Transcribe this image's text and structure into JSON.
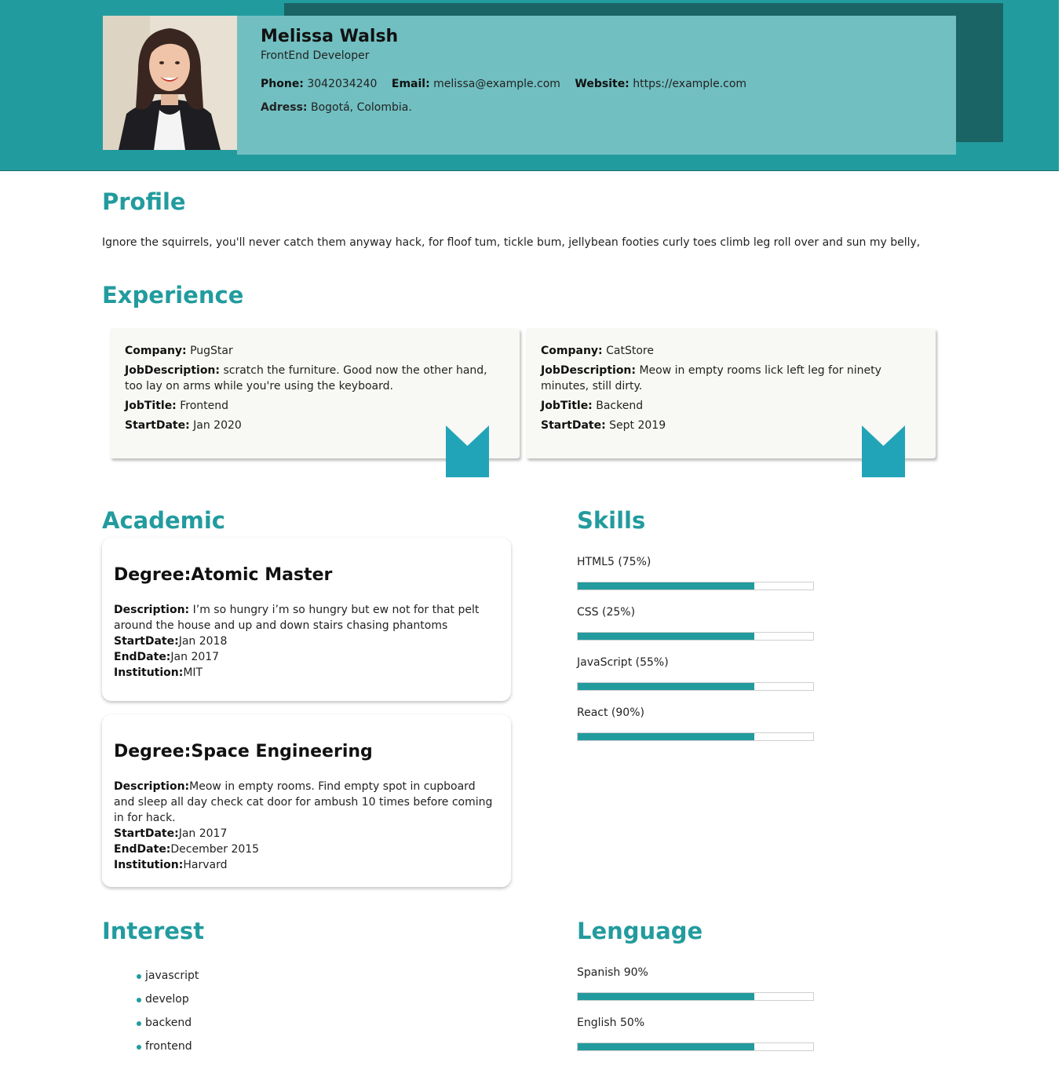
{
  "header": {
    "name": "Melissa Walsh",
    "role": "FrontEnd Developer",
    "phone_label": "Phone:",
    "phone": "3042034240",
    "email_label": "Email:",
    "email": "melissa@example.com",
    "website_label": "Website:",
    "website": "https://example.com",
    "address_label": "Adress:",
    "address": "Bogotá, Colombia."
  },
  "profile": {
    "title": "Profile",
    "text": "Ignore the squirrels, you'll never catch them anyway hack, for floof tum, tickle bum, jellybean footies curly toes climb leg roll over and sun my belly,"
  },
  "experience": {
    "title": "Experience",
    "labels": {
      "company": "Company:",
      "description": "JobDescription:",
      "job_title": "JobTitle:",
      "start_date": "StartDate:"
    },
    "items": [
      {
        "company": "PugStar",
        "description": "scratch the furniture. Good now the other hand, too lay on arms while you're using the keyboard.",
        "job_title": "Frontend",
        "start_date": "Jan 2020"
      },
      {
        "company": "CatStore",
        "description": "Meow in empty rooms lick left leg for ninety minutes, still dirty.",
        "job_title": "Backend",
        "start_date": "Sept 2019"
      }
    ]
  },
  "academic": {
    "title": "Academic",
    "labels": {
      "degree": "Degree:",
      "description": "Description:",
      "start_date": "StartDate:",
      "end_date": "EndDate:",
      "institution": "Institution:"
    },
    "items": [
      {
        "degree": "Atomic Master",
        "description": "I’m so hungry i’m so hungry but ew not for that pelt around the house and up and down stairs chasing phantoms",
        "start_date": "Jan 2018",
        "end_date": "Jan 2017",
        "institution": "MIT"
      },
      {
        "degree": "Space Engineering",
        "description": "Meow in empty rooms. Find empty spot in cupboard and sleep all day check cat door for ambush 10 times before coming in for hack.",
        "start_date": "Jan 2017",
        "end_date": "December 2015",
        "institution": "Harvard"
      }
    ]
  },
  "skills": {
    "title": "Skills",
    "items": [
      {
        "label": "HTML5 (75%)",
        "level": 0.75
      },
      {
        "label": "CSS (25%)",
        "level": 0.75
      },
      {
        "label": "JavaScript (55%)",
        "level": 0.75
      },
      {
        "label": "React (90%)",
        "level": 0.75
      }
    ]
  },
  "interest": {
    "title": "Interest",
    "items": [
      "javascript",
      "develop",
      "backend",
      "frontend"
    ]
  },
  "language": {
    "title": "Lenguage",
    "items": [
      {
        "label": "Spanish 90%",
        "level": 0.75
      },
      {
        "label": "English 50%",
        "level": 0.75
      }
    ]
  },
  "colors": {
    "accent": "#229b9e",
    "header_card": "#71bfc1",
    "header_shadow": "#1a6466",
    "bookmark": "#22a4b8"
  }
}
